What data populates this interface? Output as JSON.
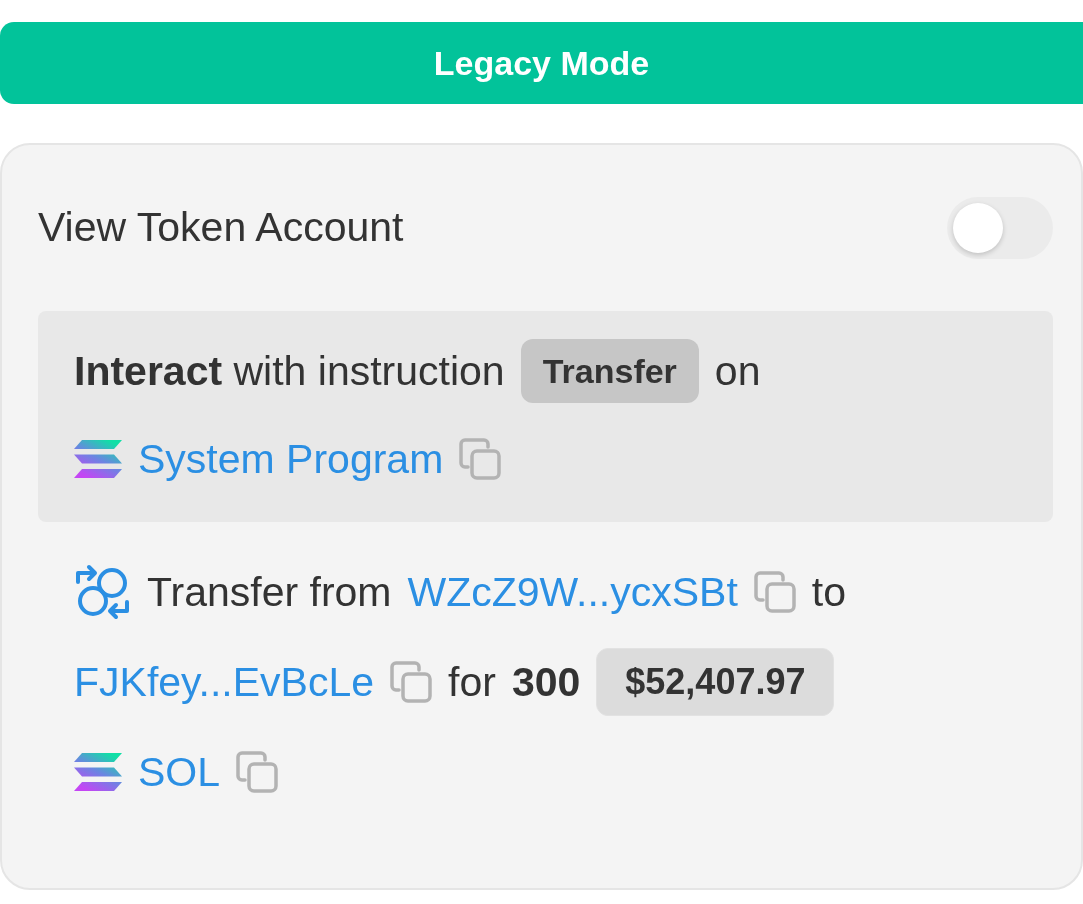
{
  "mode_button": {
    "label": "Legacy Mode"
  },
  "card": {
    "toggle": {
      "label": "View Token Account",
      "on": false
    },
    "instruction": {
      "text": "**Interact** with instruction",
      "badge": "Transfer",
      "suffix": "on",
      "program": "System Program"
    },
    "transfer": {
      "text": "Transfer from",
      "source": "WZcZ9W...ycxSBt",
      "to_text": "to",
      "destination": "FJKfey...EvBcLe",
      "for_text": "for",
      "amount": "300",
      "value": "$52,407.97",
      "token": "SOL"
    }
  }
}
